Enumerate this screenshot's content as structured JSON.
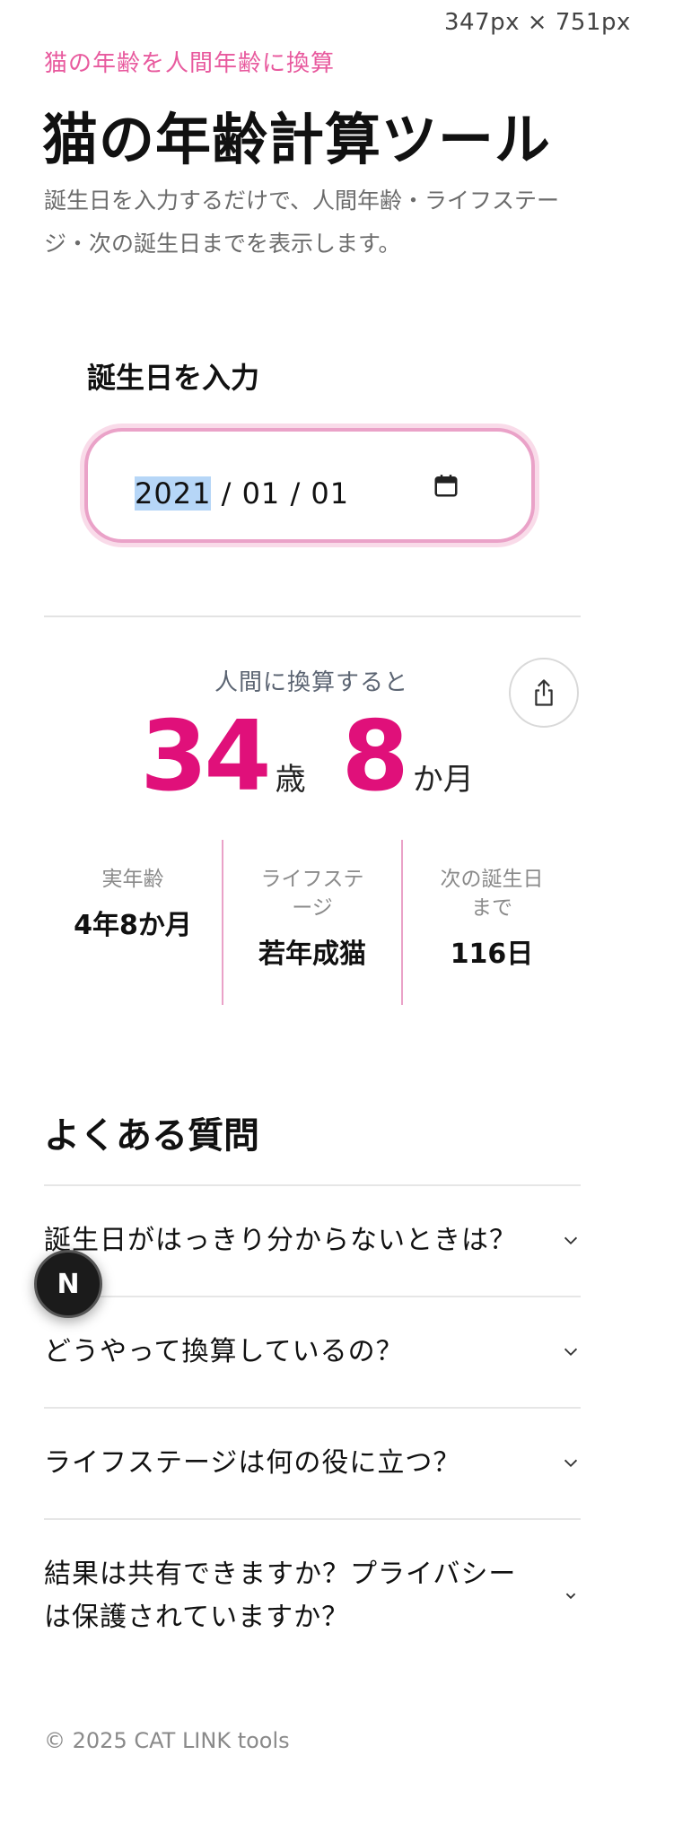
{
  "viewport_label": "347px × 751px",
  "header": {
    "eyebrow": "猫の年齢を人間年齢に換算",
    "title": "猫の年齢計算ツール",
    "lead": "誕生日を入力するだけで、人間年齢・ライフステージ・次の誕生日までを表示します。"
  },
  "form": {
    "label": "誕生日を入力",
    "date_year": "2021",
    "date_rest": "/ 01 / 01"
  },
  "result": {
    "caption": "人間に換算すると",
    "years": "34",
    "years_unit": "歳",
    "months": "8",
    "months_unit": "か月",
    "stats": [
      {
        "label": "実年齢",
        "value": "4年8か月"
      },
      {
        "label": "ライフステージ",
        "value": "若年成猫"
      },
      {
        "label": "次の誕生日まで",
        "value": "116日"
      }
    ]
  },
  "faq": {
    "title": "よくある質問",
    "items": [
      {
        "q": "誕生日がはっきり分からないときは？"
      },
      {
        "q": "どうやって換算しているの？"
      },
      {
        "q": "ライフステージは何の役に立つ？"
      },
      {
        "q": "結果は共有できますか？プライバシーは保護されていますか？"
      }
    ]
  },
  "footer": "© 2025 CAT LINK tools",
  "dev_badge": "N",
  "colors": {
    "accent": "#e0107a",
    "eyebrow": "#e85a9e",
    "input_border": "#eaa2c8"
  },
  "icons": {
    "calendar": "calendar-icon",
    "share": "share-icon",
    "chevron": "chevron-down-icon"
  }
}
